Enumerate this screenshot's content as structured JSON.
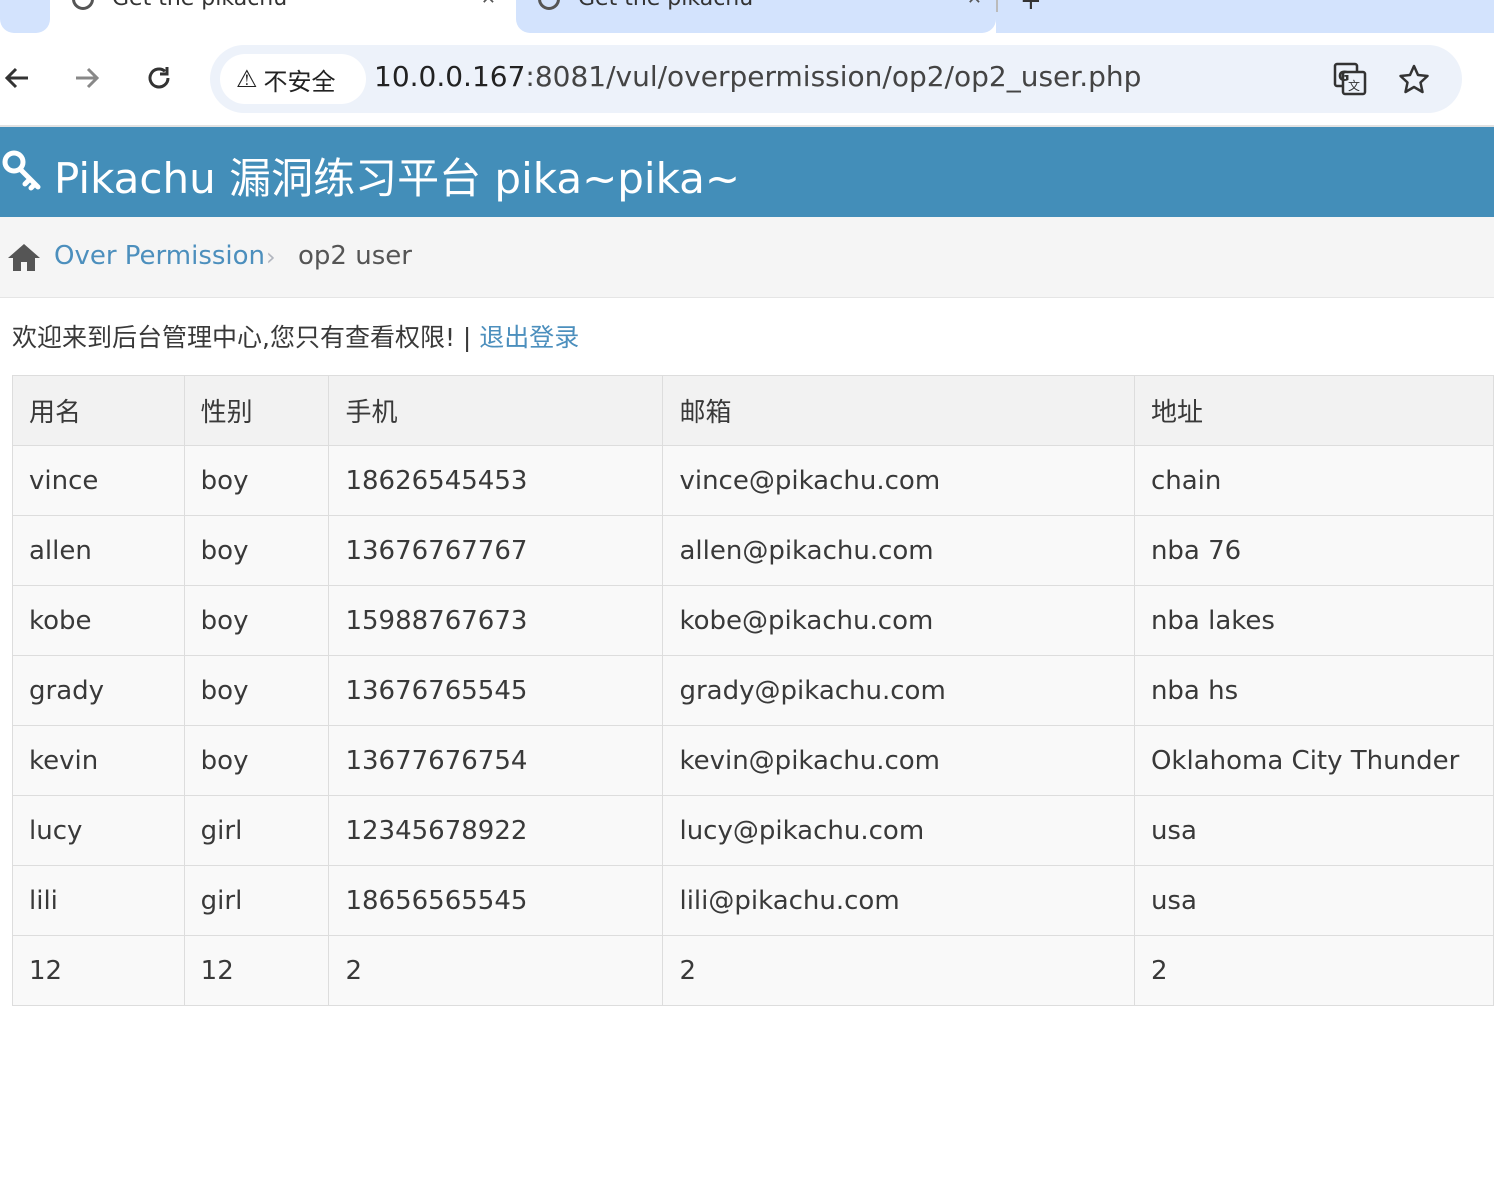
{
  "browser": {
    "tabs": [
      {
        "title": "Get the pikachu"
      },
      {
        "title": "Get the pikachu"
      }
    ],
    "security_chip": "不安全",
    "url_host": "10.0.0.167",
    "url_rest": ":8081/vul/overpermission/op2/op2_user.php"
  },
  "header": {
    "brand": "Pikachu 漏洞练习平台 pika~pika~",
    "brand_color": "#438eb9"
  },
  "breadcrumb": {
    "parent": "Over Permission",
    "current": "op2 user"
  },
  "welcome": {
    "text": "欢迎来到后台管理中心,您只有查看权限! | ",
    "logout": "退出登录"
  },
  "table": {
    "headers": [
      "用名",
      "性别",
      "手机",
      "邮箱",
      "地址"
    ],
    "rows": [
      [
        "vince",
        "boy",
        "18626545453",
        "vince@pikachu.com",
        "chain"
      ],
      [
        "allen",
        "boy",
        "13676767767",
        "allen@pikachu.com",
        "nba 76"
      ],
      [
        "kobe",
        "boy",
        "15988767673",
        "kobe@pikachu.com",
        "nba lakes"
      ],
      [
        "grady",
        "boy",
        "13676765545",
        "grady@pikachu.com",
        "nba hs"
      ],
      [
        "kevin",
        "boy",
        "13677676754",
        "kevin@pikachu.com",
        "Oklahoma City Thunder"
      ],
      [
        "lucy",
        "girl",
        "12345678922",
        "lucy@pikachu.com",
        "usa"
      ],
      [
        "lili",
        "girl",
        "18656565545",
        "lili@pikachu.com",
        "usa"
      ],
      [
        "12",
        "12",
        "2",
        "2",
        "2"
      ]
    ]
  }
}
